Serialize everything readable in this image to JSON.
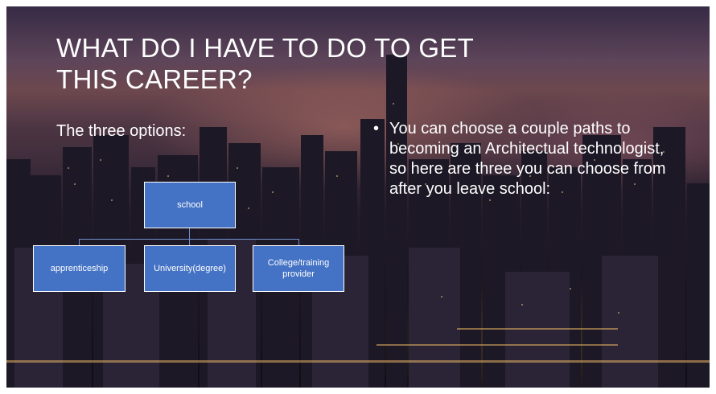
{
  "slide": {
    "title": "WHAT DO I HAVE TO DO TO GET THIS CAREER?",
    "subheading": "The three options:",
    "bullet": "You can choose a couple paths to becoming an Architectual technologist, so here are three you can choose from after you leave school:"
  },
  "org_chart": {
    "root": "school",
    "children": [
      "apprenticeship",
      "University(degree)",
      "College/training provider"
    ]
  },
  "colors": {
    "box_fill": "#4472c4",
    "text": "#ffffff"
  }
}
